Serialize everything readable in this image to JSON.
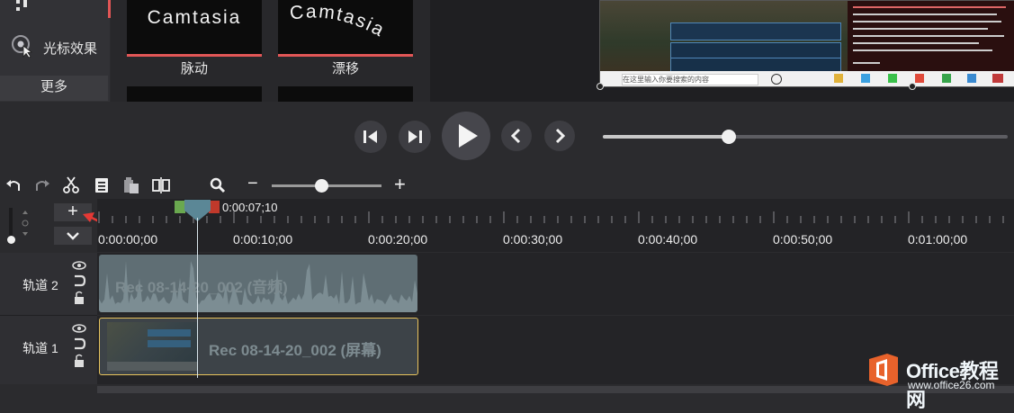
{
  "sidebar": {
    "cursor_effects": "光标效果",
    "more": "更多"
  },
  "effects": {
    "tiles": [
      {
        "preview_text": "Camtasia",
        "caption": "脉动"
      },
      {
        "preview_text": "Camtasia",
        "caption": "漂移"
      }
    ]
  },
  "preview": {
    "taskbar_search": "在这里输入你要搜索的内容"
  },
  "transport": {
    "scrub_progress": 0.31
  },
  "toolbar": {
    "zoom_minus": "−",
    "zoom_plus": "+",
    "zoom_level": 0.45
  },
  "timeline": {
    "add_track_label": "+",
    "playhead_time": "0:00:07;10",
    "ruler_labels": [
      "0:00:00;00",
      "0:00:10;00",
      "0:00:20;00",
      "0:00:30;00",
      "0:00:40;00",
      "0:00:50;00",
      "0:01:00;00"
    ],
    "tracks": [
      {
        "name": "轨道 2",
        "clip_title": "Rec 08-14-20_002 (音频)"
      },
      {
        "name": "轨道 1",
        "clip_title": "Rec 08-14-20_002 (屏幕)"
      }
    ]
  },
  "watermark": {
    "title": "Office教程网",
    "url": "www.office26.com"
  },
  "colors": {
    "accent_red": "#e25656",
    "selection_yellow": "#e7c25c",
    "playhead": "#5b8796",
    "in_marker": "#6aa84f",
    "out_marker": "#c0392b"
  }
}
